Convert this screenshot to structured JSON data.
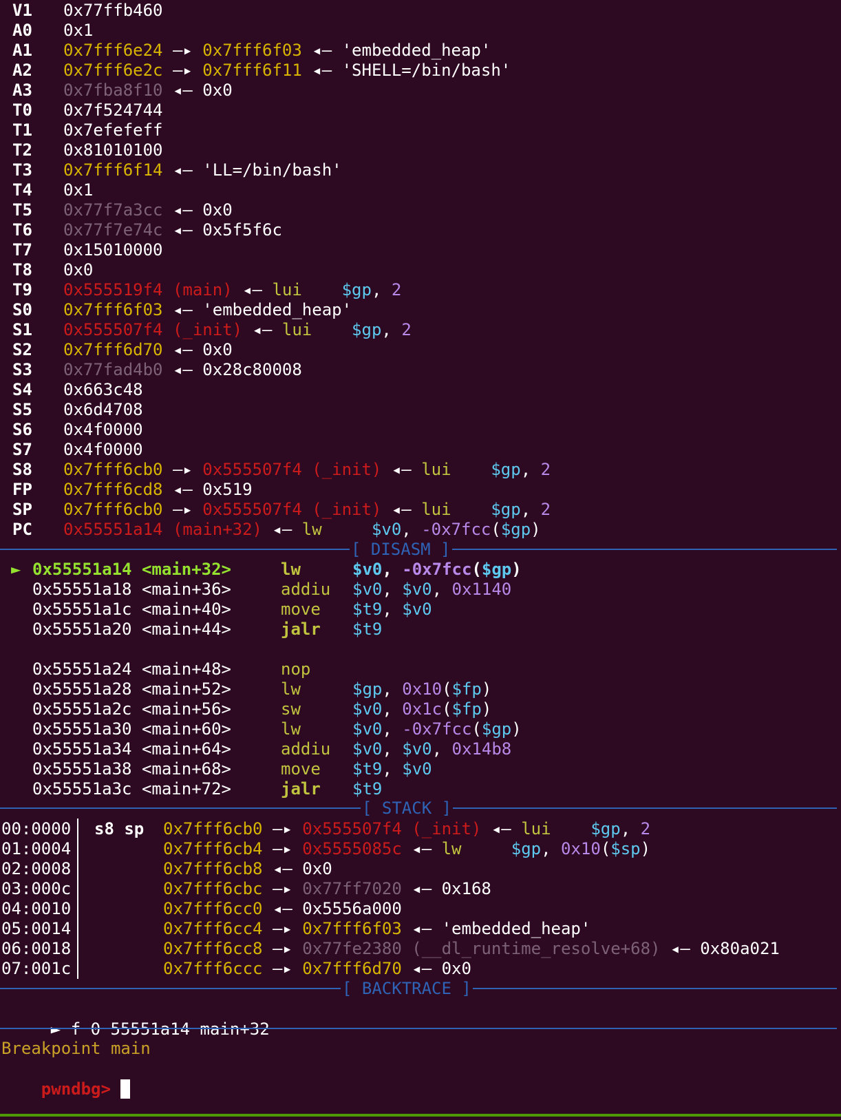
{
  "registers": [
    {
      "name": "V1",
      "value": "0x77ffb460"
    },
    {
      "name": "A0",
      "value": "0x1"
    },
    {
      "name": "A1",
      "addr": "0x7fff6e24",
      "arrow1": "—▸",
      "ptr": "0x7fff6f03",
      "arrow2": "◂—",
      "str": "'embedded_heap'"
    },
    {
      "name": "A2",
      "addr": "0x7fff6e2c",
      "arrow1": "—▸",
      "ptr": "0x7fff6f11",
      "arrow2": "◂—",
      "str": "'SHELL=/bin/bash'"
    },
    {
      "name": "A3",
      "addr": "0x7fba8f10",
      "arrow2": "◂—",
      "val": "0x0"
    },
    {
      "name": "T0",
      "value": "0x7f524744"
    },
    {
      "name": "T1",
      "value": "0x7efefeff"
    },
    {
      "name": "T2",
      "value": "0x81010100"
    },
    {
      "name": "T3",
      "addr": "0x7fff6f14",
      "arrow2": "◂—",
      "str": "'LL=/bin/bash'"
    },
    {
      "name": "T4",
      "value": "0x1"
    },
    {
      "name": "T5",
      "addr": "0x77f7a3cc",
      "arrow2": "◂—",
      "val": "0x0"
    },
    {
      "name": "T6",
      "addr": "0x77f7e74c",
      "arrow2": "◂—",
      "val": "0x5f5f6c"
    },
    {
      "name": "T7",
      "value": "0x15010000"
    },
    {
      "name": "T8",
      "value": "0x0"
    },
    {
      "name": "T9",
      "addr": "0x555519f4 (main)",
      "arrow2": "◂—",
      "mnem": "lui",
      "reg": "$gp",
      "comma": ",",
      "imm": "2"
    },
    {
      "name": "S0",
      "addr": "0x7fff6f03",
      "arrow2": "◂—",
      "str": "'embedded_heap'"
    },
    {
      "name": "S1",
      "addr": "0x555507f4 (_init)",
      "arrow2": "◂—",
      "mnem": "lui",
      "reg": "$gp",
      "comma": ",",
      "imm": "2"
    },
    {
      "name": "S2",
      "addr": "0x7fff6d70",
      "arrow2": "◂—",
      "val": "0x0"
    },
    {
      "name": "S3",
      "addr": "0x77fad4b0",
      "arrow2": "◂—",
      "val": "0x28c80008"
    },
    {
      "name": "S4",
      "value": "0x663c48"
    },
    {
      "name": "S5",
      "value": "0x6d4708"
    },
    {
      "name": "S6",
      "value": "0x4f0000"
    },
    {
      "name": "S7",
      "value": "0x4f0000"
    },
    {
      "name": "S8",
      "addr": "0x7fff6cb0",
      "arrow1": "—▸",
      "ptr": "0x555507f4 (_init)",
      "arrow2": "◂—",
      "mnem": "lui",
      "reg": "$gp",
      "comma": ",",
      "imm": "2"
    },
    {
      "name": "FP",
      "addr": "0x7fff6cd8",
      "arrow2": "◂—",
      "val": "0x519"
    },
    {
      "name": "SP",
      "addr": "0x7fff6cb0",
      "arrow1": "—▸",
      "ptr": "0x555507f4 (_init)",
      "arrow2": "◂—",
      "mnem": "lui",
      "reg": "$gp",
      "comma": ",",
      "imm": "2"
    },
    {
      "name": "PC",
      "addr": "0x55551a14 (main+32)",
      "arrow2": "◂—",
      "mnem": "lw",
      "reg": "$v0",
      "comma": ",",
      "imm": "-0x7fcc",
      "paren_open": "(",
      "reg2": "$gp",
      "paren_close": ")"
    }
  ],
  "sections": {
    "disasm": "[ DISASM ]",
    "stack": "[ STACK ]",
    "backtrace": "[ BACKTRACE ]"
  },
  "disasm": [
    {
      "current": true,
      "marker": "►",
      "addr": "0x55551a14",
      "sym": "<main+32>",
      "mnem": "lw",
      "ops": [
        [
          "b",
          "$v0"
        ],
        [
          "w",
          ", "
        ],
        [
          "p",
          "-0x7fcc"
        ],
        [
          "w",
          "("
        ],
        [
          "b",
          "$gp"
        ],
        [
          "w",
          ")"
        ]
      ]
    },
    {
      "addr": "0x55551a18",
      "sym": "<main+36>",
      "mnem": "addiu",
      "ops": [
        [
          "b",
          "$v0"
        ],
        [
          "w",
          ", "
        ],
        [
          "b",
          "$v0"
        ],
        [
          "w",
          ", "
        ],
        [
          "p",
          "0x1140"
        ]
      ]
    },
    {
      "addr": "0x55551a1c",
      "sym": "<main+40>",
      "mnem": "move",
      "ops": [
        [
          "b",
          "$t9"
        ],
        [
          "w",
          ", "
        ],
        [
          "b",
          "$v0"
        ]
      ]
    },
    {
      "addr": "0x55551a20",
      "sym": "<main+44>",
      "mnem": "jalr",
      "bold": true,
      "ops": [
        [
          "b",
          "$t9"
        ]
      ]
    },
    {
      "blank": true
    },
    {
      "addr": "0x55551a24",
      "sym": "<main+48>",
      "mnem": "nop",
      "ops": []
    },
    {
      "addr": "0x55551a28",
      "sym": "<main+52>",
      "mnem": "lw",
      "ops": [
        [
          "b",
          "$gp"
        ],
        [
          "w",
          ", "
        ],
        [
          "p",
          "0x10"
        ],
        [
          "w",
          "("
        ],
        [
          "b",
          "$fp"
        ],
        [
          "w",
          ")"
        ]
      ]
    },
    {
      "addr": "0x55551a2c",
      "sym": "<main+56>",
      "mnem": "sw",
      "ops": [
        [
          "b",
          "$v0"
        ],
        [
          "w",
          ", "
        ],
        [
          "p",
          "0x1c"
        ],
        [
          "w",
          "("
        ],
        [
          "b",
          "$fp"
        ],
        [
          "w",
          ")"
        ]
      ]
    },
    {
      "addr": "0x55551a30",
      "sym": "<main+60>",
      "mnem": "lw",
      "ops": [
        [
          "b",
          "$v0"
        ],
        [
          "w",
          ", "
        ],
        [
          "p",
          "-0x7fcc"
        ],
        [
          "w",
          "("
        ],
        [
          "b",
          "$gp"
        ],
        [
          "w",
          ")"
        ]
      ]
    },
    {
      "addr": "0x55551a34",
      "sym": "<main+64>",
      "mnem": "addiu",
      "ops": [
        [
          "b",
          "$v0"
        ],
        [
          "w",
          ", "
        ],
        [
          "b",
          "$v0"
        ],
        [
          "w",
          ", "
        ],
        [
          "p",
          "0x14b8"
        ]
      ]
    },
    {
      "addr": "0x55551a38",
      "sym": "<main+68>",
      "mnem": "move",
      "ops": [
        [
          "b",
          "$t9"
        ],
        [
          "w",
          ", "
        ],
        [
          "b",
          "$v0"
        ]
      ]
    },
    {
      "addr": "0x55551a3c",
      "sym": "<main+72>",
      "mnem": "jalr",
      "bold": true,
      "ops": [
        [
          "b",
          "$t9"
        ]
      ]
    }
  ],
  "stack": [
    {
      "off": "00:0000",
      "regs": "s8 sp",
      "parts": [
        [
          "y",
          "0x7fff6cb0"
        ],
        [
          "w",
          " —▸ "
        ],
        [
          "r",
          "0x555507f4 (_init)"
        ],
        [
          "w",
          " ◂— "
        ],
        [
          "g",
          "lui    "
        ],
        [
          "b",
          "$gp"
        ],
        [
          "w",
          ", "
        ],
        [
          "p",
          "2"
        ]
      ]
    },
    {
      "off": "01:0004",
      "regs": "",
      "parts": [
        [
          "y",
          "0x7fff6cb4"
        ],
        [
          "w",
          " —▸ "
        ],
        [
          "r",
          "0x5555085c"
        ],
        [
          "w",
          " ◂— "
        ],
        [
          "g",
          "lw     "
        ],
        [
          "b",
          "$gp"
        ],
        [
          "w",
          ", "
        ],
        [
          "p",
          "0x10"
        ],
        [
          "w",
          "("
        ],
        [
          "b",
          "$sp"
        ],
        [
          "w",
          ")"
        ]
      ]
    },
    {
      "off": "02:0008",
      "regs": "",
      "parts": [
        [
          "y",
          "0x7fff6cb8"
        ],
        [
          "w",
          " ◂— 0x0"
        ]
      ]
    },
    {
      "off": "03:000c",
      "regs": "",
      "parts": [
        [
          "y",
          "0x7fff6cbc"
        ],
        [
          "w",
          " —▸ "
        ],
        [
          "m",
          "0x77ff7020"
        ],
        [
          "w",
          " ◂— 0x168"
        ]
      ]
    },
    {
      "off": "04:0010",
      "regs": "",
      "parts": [
        [
          "y",
          "0x7fff6cc0"
        ],
        [
          "w",
          " ◂— 0x5556a000"
        ]
      ]
    },
    {
      "off": "05:0014",
      "regs": "",
      "parts": [
        [
          "y",
          "0x7fff6cc4"
        ],
        [
          "w",
          " —▸ "
        ],
        [
          "y",
          "0x7fff6f03"
        ],
        [
          "w",
          " ◂— 'embedded_heap'"
        ]
      ]
    },
    {
      "off": "06:0018",
      "regs": "",
      "parts": [
        [
          "y",
          "0x7fff6cc8"
        ],
        [
          "w",
          " —▸ "
        ],
        [
          "m",
          "0x77fe2380 (__dl_runtime_resolve+68)"
        ],
        [
          "w",
          " ◂— 0x80a021"
        ]
      ]
    },
    {
      "off": "07:001c",
      "regs": "",
      "parts": [
        [
          "y",
          "0x7fff6ccc"
        ],
        [
          "w",
          " —▸ "
        ],
        [
          "y",
          "0x7fff6d70"
        ],
        [
          "w",
          " ◂— 0x0"
        ]
      ]
    }
  ],
  "backtrace": {
    "marker": "►",
    "text": " f 0 55551a14 main+32"
  },
  "console": {
    "message": "Breakpoint main",
    "prompt": "pwndbg> "
  }
}
